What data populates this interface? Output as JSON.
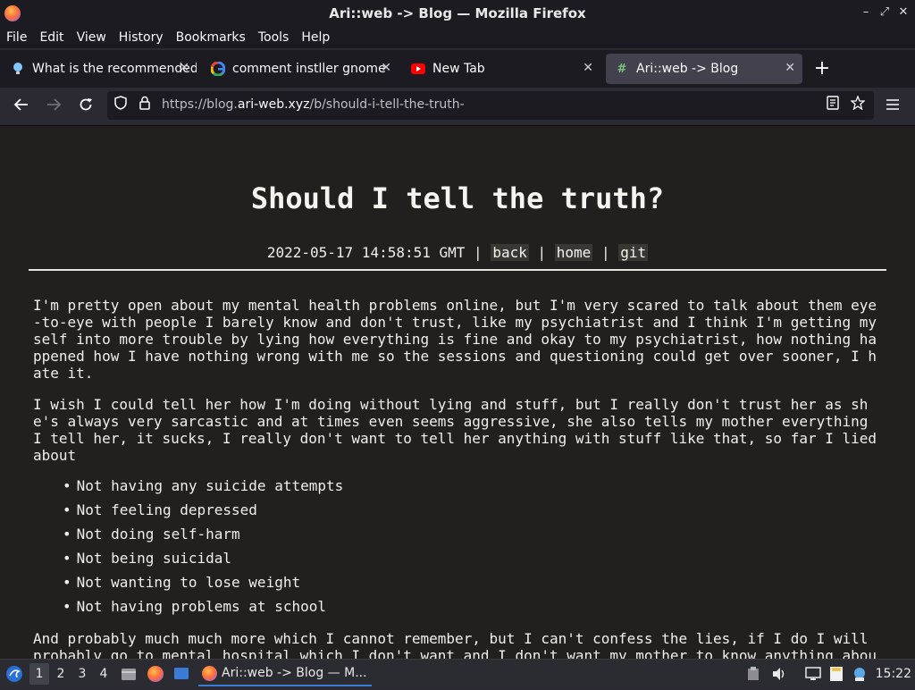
{
  "window": {
    "title": "Ari::web -> Blog — Mozilla Firefox",
    "controls": [
      "–",
      "⤢",
      "✕"
    ]
  },
  "menubar": [
    "File",
    "Edit",
    "View",
    "History",
    "Bookmarks",
    "Tools",
    "Help"
  ],
  "tabs": [
    {
      "label": "What is the recommended",
      "icon": "bulb-icon",
      "close": "✕"
    },
    {
      "label": "comment instller gnome",
      "icon": "google-icon",
      "close": "✕"
    },
    {
      "label": "New Tab",
      "icon": "youtube-icon",
      "close": "✕"
    },
    {
      "label": "Ari::web -> Blog",
      "icon": "hash-icon",
      "close": "✕",
      "active": true
    }
  ],
  "newtab": "+",
  "nav": {
    "url_prefix": "https://blog.",
    "url_domain": "ari-web.xyz",
    "url_path": "/b/should-i-tell-the-truth-"
  },
  "page": {
    "title": "Should I tell the truth?",
    "date": "2022-05-17 14:58:51 GMT",
    "sep": "|",
    "links": {
      "back": "back",
      "home": "home",
      "git": "git"
    },
    "paragraphs": [
      "I'm pretty open about my mental health problems online, but I'm very scared to talk about them eye-to-eye with people I barely know and don't trust, like my psychiatrist and I think I'm getting myself into more trouble by lying how everything is fine and okay to my psychiatrist, how nothing happened how I have nothing wrong with me so the sessions and questioning could get over sooner, I hate it.",
      "I wish I could tell her how I'm doing without lying and stuff, but I really don't trust her as she's always very sarcastic and at times even seems aggressive, she also tells my mother everything I tell her, it sucks, I really don't want to tell her anything with stuff like that, so far I lied about",
      "And probably much much more which I cannot remember, but I can't confess the lies, if I do I will probably go to mental hospital which I don't want and I don't want my mother to know anything about"
    ],
    "list": [
      "Not having any suicide attempts",
      "Not feeling depressed",
      "Not doing self-harm",
      "Not being suicidal",
      "Not wanting to lose weight",
      "Not having problems at school"
    ]
  },
  "taskbar": {
    "workspaces": [
      "1",
      "2",
      "3",
      "4"
    ],
    "task": "Ari::web -> Blog — M...",
    "clock": "15:22"
  }
}
